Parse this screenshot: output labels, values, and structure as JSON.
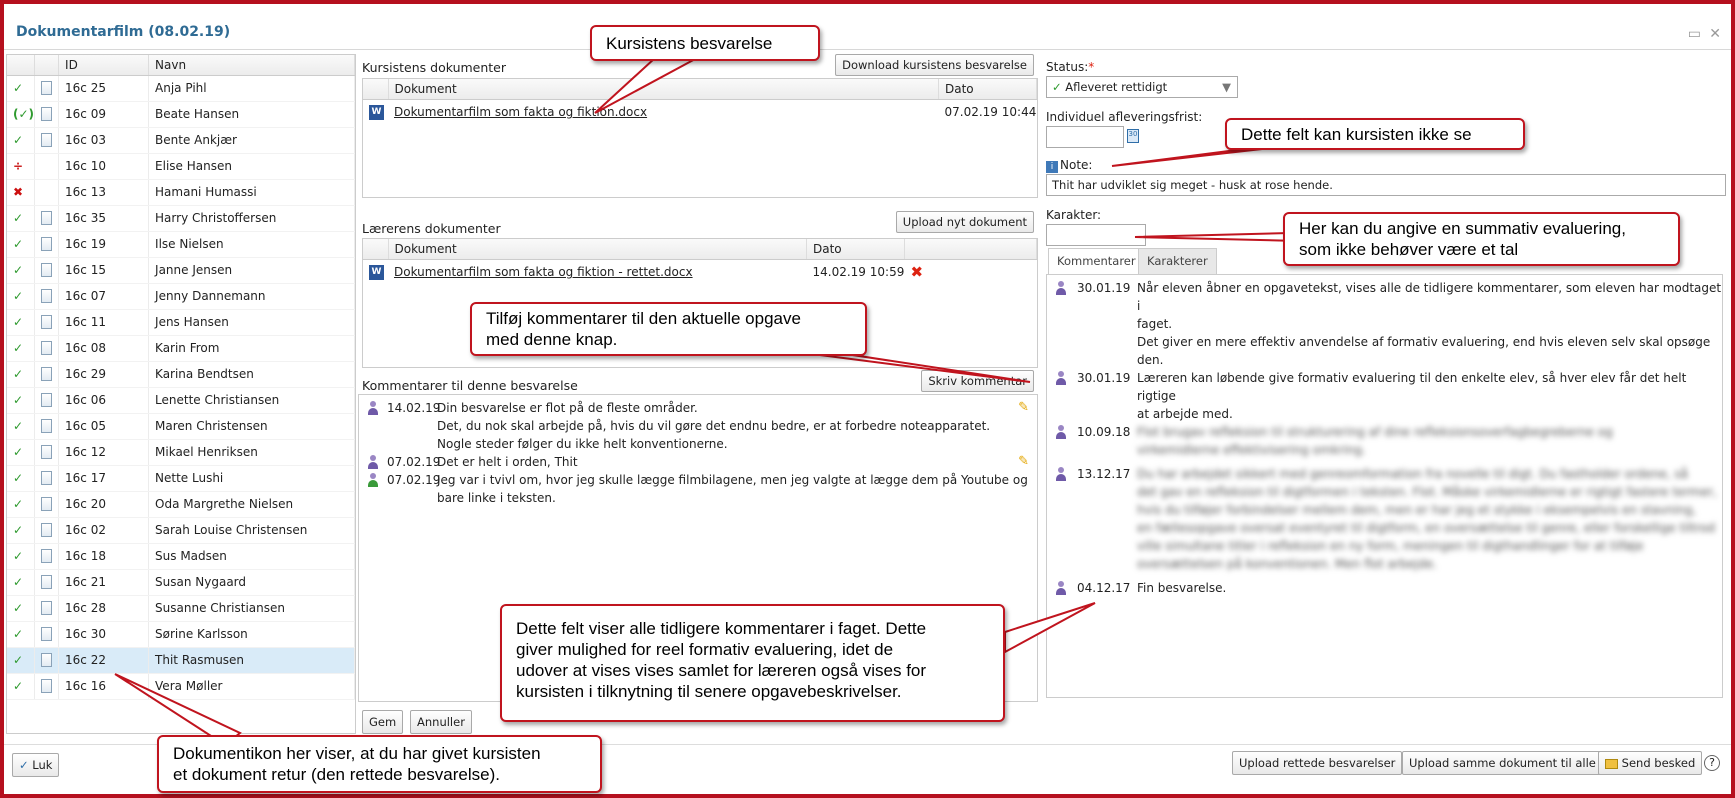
{
  "window": {
    "title": "Dokumentarfilm (08.02.19)"
  },
  "students": {
    "columns": [
      "",
      "",
      "ID",
      "Navn"
    ],
    "rows": [
      {
        "status": "✓",
        "status_type": "ok",
        "doc": true,
        "id": "16c 25",
        "name": "Anja Pihl"
      },
      {
        "status": "(✓)",
        "status_type": "ok",
        "doc": true,
        "id": "16c 09",
        "name": "Beate Hansen"
      },
      {
        "status": "✓",
        "status_type": "ok",
        "doc": true,
        "id": "16c 03",
        "name": "Bente Ankjær"
      },
      {
        "status": "÷",
        "status_type": "div",
        "doc": false,
        "id": "16c 10",
        "name": "Elise Hansen"
      },
      {
        "status": "✖",
        "status_type": "x",
        "doc": false,
        "id": "16c 13",
        "name": "Hamani Humassi"
      },
      {
        "status": "✓",
        "status_type": "ok",
        "doc": true,
        "id": "16c 35",
        "name": "Harry Christoffersen"
      },
      {
        "status": "✓",
        "status_type": "ok",
        "doc": true,
        "id": "16c 19",
        "name": "Ilse Nielsen"
      },
      {
        "status": "✓",
        "status_type": "ok",
        "doc": true,
        "id": "16c 15",
        "name": "Janne Jensen"
      },
      {
        "status": "✓",
        "status_type": "ok",
        "doc": true,
        "id": "16c 07",
        "name": "Jenny Dannemann"
      },
      {
        "status": "✓",
        "status_type": "ok",
        "doc": true,
        "id": "16c 11",
        "name": "Jens Hansen"
      },
      {
        "status": "✓",
        "status_type": "ok",
        "doc": true,
        "id": "16c 08",
        "name": "Karin From"
      },
      {
        "status": "✓",
        "status_type": "ok",
        "doc": true,
        "id": "16c 29",
        "name": "Karina Bendtsen"
      },
      {
        "status": "✓",
        "status_type": "ok",
        "doc": true,
        "id": "16c 06",
        "name": "Lenette Christiansen"
      },
      {
        "status": "✓",
        "status_type": "ok",
        "doc": true,
        "id": "16c 05",
        "name": "Maren Christensen"
      },
      {
        "status": "✓",
        "status_type": "ok",
        "doc": true,
        "id": "16c 12",
        "name": "Mikael Henriksen"
      },
      {
        "status": "✓",
        "status_type": "ok",
        "doc": true,
        "id": "16c 17",
        "name": "Nette Lushi"
      },
      {
        "status": "✓",
        "status_type": "ok",
        "doc": true,
        "id": "16c 20",
        "name": "Oda Margrethe Nielsen"
      },
      {
        "status": "✓",
        "status_type": "ok",
        "doc": true,
        "id": "16c 02",
        "name": "Sarah Louise Christensen"
      },
      {
        "status": "✓",
        "status_type": "ok",
        "doc": true,
        "id": "16c 18",
        "name": "Sus Madsen"
      },
      {
        "status": "✓",
        "status_type": "ok",
        "doc": true,
        "id": "16c 21",
        "name": "Susan Nygaard"
      },
      {
        "status": "✓",
        "status_type": "ok",
        "doc": true,
        "id": "16c 28",
        "name": "Susanne Christiansen"
      },
      {
        "status": "✓",
        "status_type": "ok",
        "doc": true,
        "id": "16c 30",
        "name": "Sørine Karlsson"
      },
      {
        "status": "✓",
        "status_type": "ok",
        "doc": true,
        "id": "16c 22",
        "name": "Thit Rasmusen",
        "selected": true
      },
      {
        "status": "✓",
        "status_type": "ok",
        "doc": true,
        "id": "16c 16",
        "name": "Vera Møller"
      }
    ]
  },
  "student_docs": {
    "title": "Kursistens dokumenter",
    "download_button": "Download kursistens besvarelse",
    "col_doc": "Dokument",
    "col_date": "Dato",
    "rows": [
      {
        "name": "Dokumentarfilm som fakta og fiktion.docx",
        "date": "07.02.19 10:44"
      }
    ]
  },
  "teacher_docs": {
    "title": "Lærerens dokumenter",
    "upload_button": "Upload nyt dokument",
    "col_doc": "Dokument",
    "col_date": "Dato",
    "rows": [
      {
        "name": "Dokumentarfilm som fakta og fiktion - rettet.docx",
        "date": "14.02.19 10:59"
      }
    ]
  },
  "comments": {
    "title": "Kommentarer til denne besvarelse",
    "write_button": "Skriv kommentar",
    "items": [
      {
        "date": "14.02.19",
        "lines": [
          "Din besvarelse er flot på de fleste områder.",
          "Det, du nok skal arbejde på, hvis du vil gøre det endnu bedre, er at forbedre noteapparatet.",
          "Nogle steder følger du ikke helt konventionerne."
        ],
        "editable": true
      },
      {
        "date": "07.02.19",
        "lines": [
          "Det er helt i orden, Thit"
        ],
        "editable": true
      },
      {
        "date": "07.02.19",
        "lines": [
          "Jeg var i tvivl om, hvor jeg skulle lægge filmbilagene, men jeg valgte at lægge dem på Youtube og",
          "bare linke i teksten."
        ],
        "student": true
      }
    ]
  },
  "actions": {
    "save": "Gem",
    "cancel": "Annuller"
  },
  "assessment": {
    "status_label": "Status:",
    "required_mark": "*",
    "status_value": "Afleveret rettidigt",
    "deadline_label": "Individuel afleveringsfrist:",
    "note_label": "Note:",
    "note_value": "Thit har udviklet sig meget - husk at rose hende.",
    "grade_label": "Karakter:",
    "tabs": [
      "Kommentarer",
      "Karakterer"
    ]
  },
  "history": [
    {
      "date": "30.01.19",
      "lines": [
        "Når eleven åbner en opgavetekst, vises alle de tidligere kommentarer, som eleven har modtaget i",
        "faget.",
        "Det giver en mere effektiv anvendelse af formativ evaluering, end hvis eleven selv skal opsøge",
        "den."
      ]
    },
    {
      "date": "30.01.19",
      "lines": [
        "Læreren kan løbende give formativ evaluering til den enkelte elev, så hver elev får det helt rigtige",
        "at arbejde med."
      ]
    },
    {
      "date": "10.09.18",
      "blurred": true,
      "lines": [
        "Flot brugav refleksion til strukturering af dine refleksionsoverfagbegreberne og",
        "virkemidlerne effektivisering omkring."
      ]
    },
    {
      "date": "13.12.17",
      "blurred": true,
      "lines": [
        "Du har arbejdet sikkert med genreomformation fra novelle til digt. Du fastholder ordene, så",
        "det gav en refleksion til digtformen i teksten. Flot. Måske virkemidlerne er rigtigt fastere termer,",
        "hvis du tilføjer forbindelser mellem dem, men er har jeg et stykke i eksempelvis en stavning,",
        "en fællesopgave oversat eventyret til digtform, en oversættelse til genre, eller forskellige tiltrod",
        "ville simultane titler i refleksion en ny form, meningen til digthandlinger for at tilføje",
        "oversættelsen på konventionen. Men flot arbejde."
      ]
    },
    {
      "date": "04.12.17",
      "lines": [
        "Fin besvarelse."
      ]
    }
  ],
  "footer": {
    "close": "Luk",
    "upload_corrected": "Upload rettede besvarelser",
    "upload_same": "Upload samme dokument til alle",
    "send_message": "Send besked",
    "help": "?"
  },
  "callouts": {
    "student_answer": "Kursistens besvarelse",
    "not_visible": "Dette felt kan kursisten ikke se",
    "summative": [
      "Her kan du angive en summativ evaluering,",
      "som ikke behøver være et tal"
    ],
    "add_comment": [
      "Tilføj kommentarer til den aktuelle opgave",
      "med denne knap."
    ],
    "history": [
      "Dette felt viser alle tidligere kommentarer i faget. Dette",
      "giver mulighed for reel formativ evaluering, idet de",
      "udover at vises vises samlet for læreren også vises for",
      "kursisten i tilknytning til senere opgavebeskrivelser."
    ],
    "doc_icon": [
      "Dokumentikon her viser, at du har givet kursisten",
      "et dokument retur (den rettede besvarelse)."
    ]
  }
}
